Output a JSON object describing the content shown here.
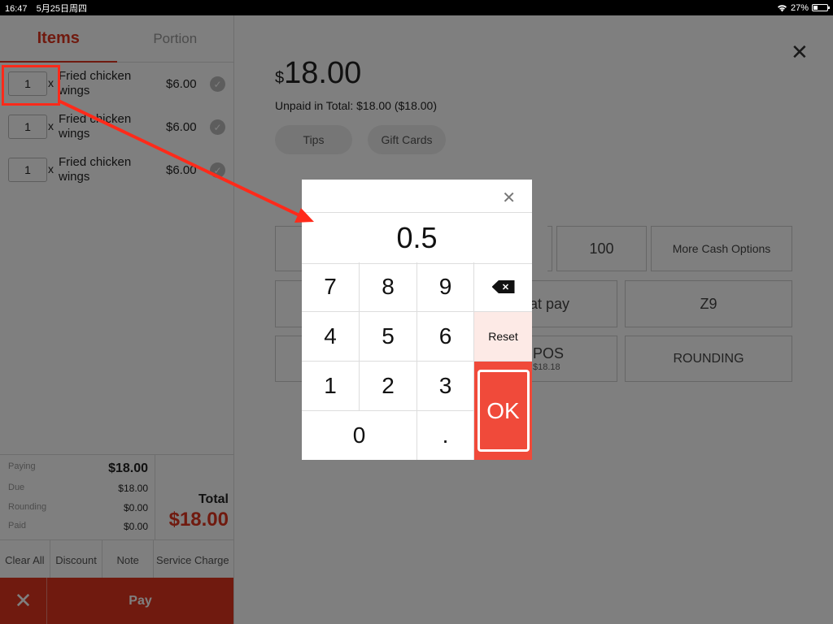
{
  "status_bar": {
    "time": "16:47",
    "date": "5月25日周四",
    "battery": "27%"
  },
  "tabs": [
    {
      "label": "Items"
    },
    {
      "label": "Portion"
    }
  ],
  "items": [
    {
      "qty": "1",
      "times": "x",
      "name": "Fried chicken wings",
      "price": "$6.00"
    },
    {
      "qty": "1",
      "times": "x",
      "name": "Fried chicken wings",
      "price": "$6.00"
    },
    {
      "qty": "1",
      "times": "x",
      "name": "Fried chicken wings",
      "price": "$6.00"
    }
  ],
  "summary": {
    "paying_label": "Paying",
    "paying_value": "$18.00",
    "due_label": "Due",
    "due_value": "$18.00",
    "rounding_label": "Rounding",
    "rounding_value": "$0.00",
    "paid_label": "Paid",
    "paid_value": "$0.00",
    "total_label": "Total",
    "total_value": "$18.00"
  },
  "actions": {
    "clear_all": "Clear All",
    "discount": "Discount",
    "note": "Note",
    "service_charge": "Service Charge"
  },
  "paybar": {
    "close": "✕",
    "pay": "Pay"
  },
  "payment": {
    "currency": "$",
    "amount": "18.00",
    "unpaid_text": "Unpaid in Total: $18.00 ($18.00)",
    "tips": "Tips",
    "gift_cards": "Gift Cards",
    "btn_100": "100",
    "more_cash": "More Cash Options",
    "wechat_pay_partial": "at pay",
    "z9": "Z9",
    "pos_partial": "POS",
    "pos_amount": "$18.18",
    "rounding": "ROUNDING"
  },
  "keypad": {
    "value": "0.5",
    "keys": {
      "k7": "7",
      "k8": "8",
      "k9": "9",
      "k4": "4",
      "k5": "5",
      "k6": "6",
      "k1": "1",
      "k2": "2",
      "k3": "3",
      "k0": "0",
      "dot": "."
    },
    "reset": "Reset",
    "ok": "OK"
  },
  "colors": {
    "accent": "#e0341e",
    "ok_button": "#f04a3a",
    "highlight": "#ff2a1a"
  }
}
